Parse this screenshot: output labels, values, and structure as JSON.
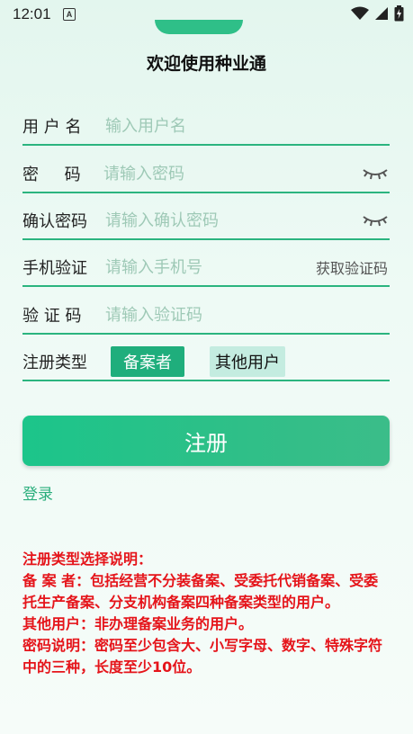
{
  "status_bar": {
    "time": "12:01",
    "badge": "A"
  },
  "welcome": "欢迎使用种业通",
  "form": {
    "username": {
      "label": "用 户 名",
      "placeholder": "输入用户名"
    },
    "password": {
      "label": "密     码",
      "placeholder": "请输入密码"
    },
    "confirm": {
      "label": "确认密码",
      "placeholder": "请输入确认密码"
    },
    "phone": {
      "label": "手机验证",
      "placeholder": "请输入手机号",
      "action": "获取验证码"
    },
    "code": {
      "label": "验 证 码",
      "placeholder": "请输入验证码"
    },
    "type": {
      "label": "注册类型",
      "options": [
        "备案者",
        "其他用户"
      ],
      "selected": "备案者"
    }
  },
  "submit_label": "注册",
  "login_label": "登录",
  "notes": [
    "注册类型选择说明：",
    "备 案 者：包括经营不分装备案、受委托代销备案、受委托生产备案、分支机构备案四种备案类型的用户。",
    "其他用户：非办理备案业务的用户。",
    "密码说明：密码至少包含大、小写字母、数字、特殊字符中的三种，长度至少10位。"
  ],
  "colors": {
    "accent": "#2bb47f",
    "note_red": "#e5141a",
    "placeholder": "#9ec9b6"
  }
}
